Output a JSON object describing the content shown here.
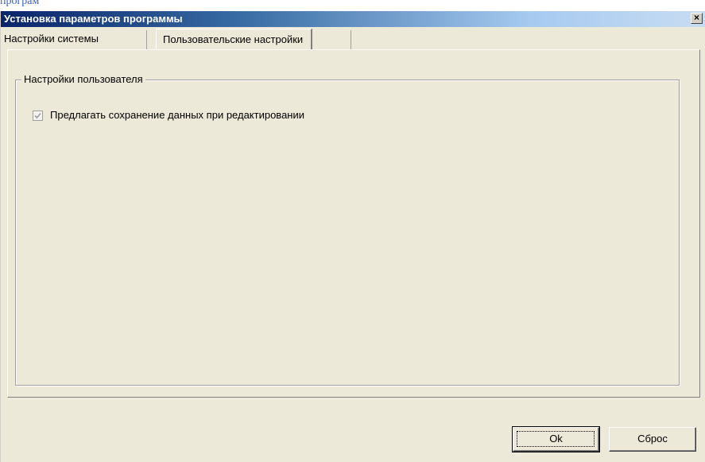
{
  "window": {
    "title": "Установка параметров программы",
    "close_glyph": "×"
  },
  "tabs": [
    {
      "label": "Настройки системы",
      "active": false
    },
    {
      "label": "Пользовательские настройки",
      "active": true
    }
  ],
  "group": {
    "legend": "Настройки пользователя",
    "checkbox": {
      "label": "Предлагать сохранение данных при редактировании",
      "checked": true,
      "enabled": false
    }
  },
  "buttons": {
    "ok_label": "Ok",
    "reset_label": "Сброс"
  },
  "colors": {
    "title_gradient_start": "#0a246a",
    "title_gradient_end": "#c8dcf2",
    "dialog_face": "#ece9d8"
  }
}
